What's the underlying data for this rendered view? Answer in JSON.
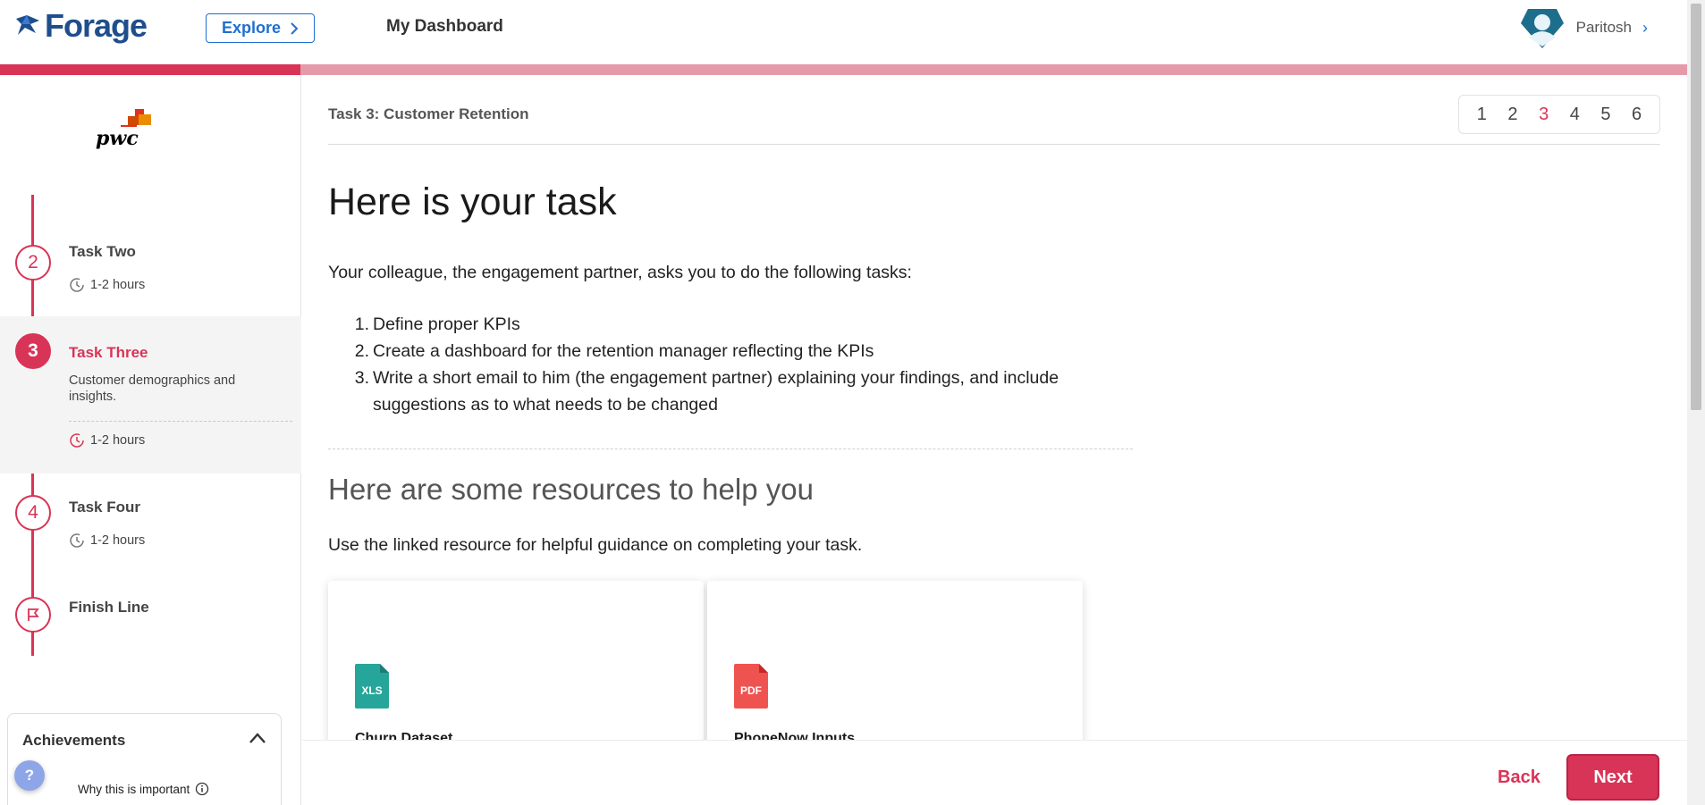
{
  "header": {
    "logo_text": "Forage",
    "explore_label": "Explore",
    "dashboard_label": "My Dashboard",
    "user_name": "Paritosh",
    "brand_color": "#1f4e8c",
    "accent_color": "#d83457"
  },
  "progress": {
    "fraction": 0.178
  },
  "sidebar": {
    "company_logo_text": "pwc",
    "tasks": [
      {
        "number": "2",
        "title": "Task Two",
        "time": "1-2 hours",
        "state": "done"
      },
      {
        "number": "3",
        "title": "Task Three",
        "description": "Customer demographics and insights.",
        "time": "1-2 hours",
        "state": "active"
      },
      {
        "number": "4",
        "title": "Task Four",
        "time": "1-2 hours",
        "state": "upcoming"
      },
      {
        "title": "Finish Line",
        "icon": "flag-icon",
        "state": "upcoming"
      }
    ],
    "achievements": {
      "title": "Achievements",
      "why_label": "Why this is important"
    },
    "help_label": "?"
  },
  "main": {
    "task_header": "Task 3: Customer Retention",
    "pager": [
      "1",
      "2",
      "3",
      "4",
      "5",
      "6"
    ],
    "pager_current": "3",
    "heading": "Here is your task",
    "intro": "Your colleague, the engagement partner, asks you to do the following tasks:",
    "task_list": [
      {
        "num": "1.",
        "text": "Define proper KPIs"
      },
      {
        "num": "2.",
        "text": "Create a dashboard for the retention manager reflecting the KPIs"
      },
      {
        "num": "3.",
        "text": "Write a short email to him (the engagement partner) explaining your findings, and include suggestions as to what needs to be changed"
      }
    ],
    "resources_heading": "Here are some resources to help you",
    "resources_intro": "Use the linked resource for helpful guidance on completing your task.",
    "resources": [
      {
        "type": "XLS",
        "label": "Churn Dataset",
        "color": "#26a69a"
      },
      {
        "type": "PDF",
        "label": "PhoneNow Inputs",
        "color": "#ef5350"
      }
    ]
  },
  "footer": {
    "back_label": "Back",
    "next_label": "Next"
  }
}
